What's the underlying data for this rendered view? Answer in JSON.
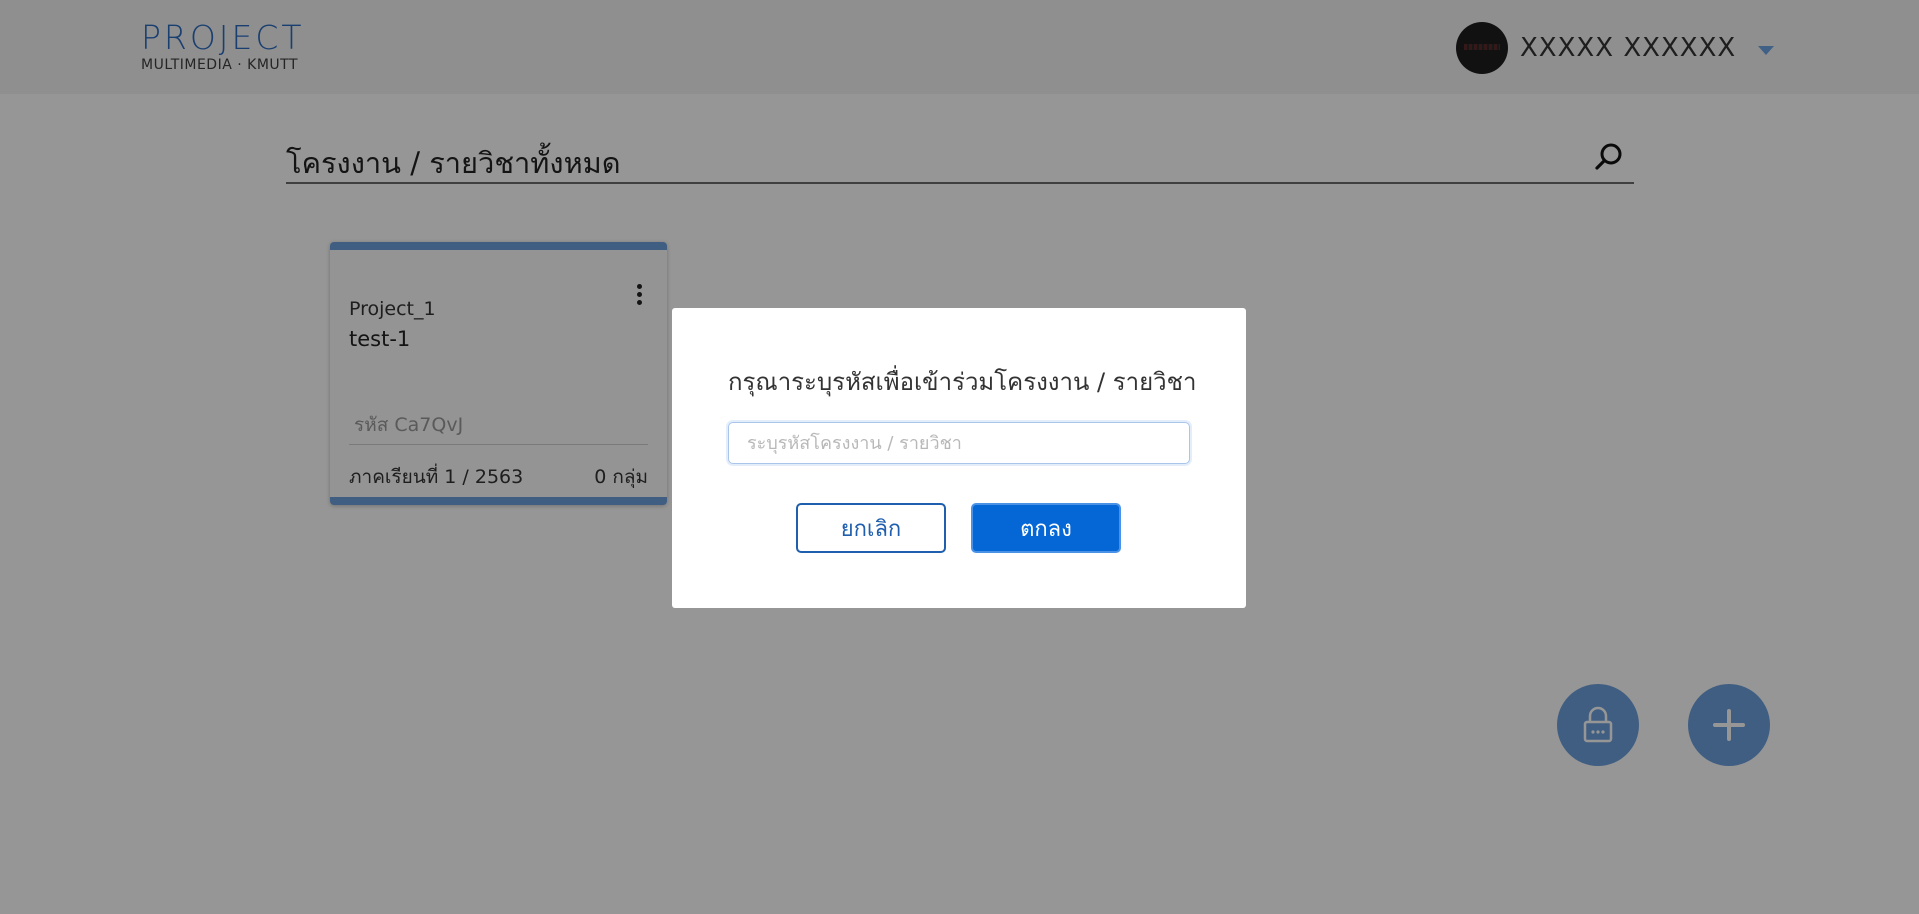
{
  "header": {
    "logo_main": "PROJECT",
    "logo_sub": "MULTIMEDIA · KMUTT",
    "user_name": "XXXXX XXXXXX"
  },
  "search": {
    "label": "โครงงาน / รายวิชาทั้งหมด"
  },
  "cards": [
    {
      "project": "Project_1",
      "subject": "test-1",
      "code": "รหัส Ca7QvJ",
      "term": "ภาคเรียนที่ 1 / 2563",
      "groups": "0 กลุ่ม"
    }
  ],
  "modal": {
    "title": "กรุณาระบุรหัสเพื่อเข้าร่วมโครงงาน / รายวิชา",
    "input_placeholder": "ระบุรหัสโครงงาน / รายวิชา",
    "input_value": "",
    "cancel_label": "ยกเลิก",
    "ok_label": "ตกลง"
  },
  "icons": {
    "search": "search-icon",
    "more": "more-vertical-icon",
    "lock": "lock-icon",
    "add": "plus-icon",
    "caret": "chevron-down-icon"
  },
  "colors": {
    "accent": "#6ea1dd",
    "primary_button": "#0566d6",
    "logo": "#2b6cc0",
    "overlay": "rgba(0,0,0,0.41)"
  }
}
